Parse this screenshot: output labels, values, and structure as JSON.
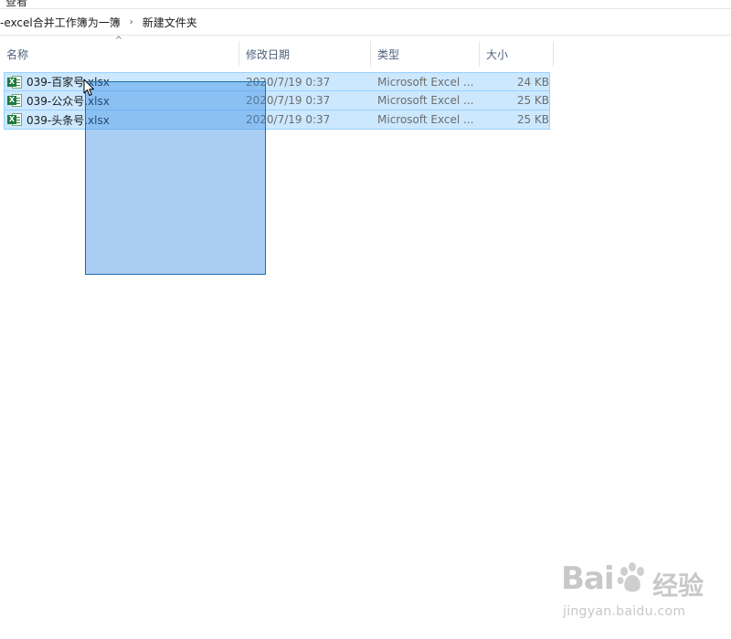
{
  "window": {
    "ribbon_remnant_label": "查看"
  },
  "breadcrumb": {
    "items": [
      "-excel合并工作簿为一簿",
      "新建文件夹"
    ],
    "separator": "›"
  },
  "columns": {
    "name": "名称",
    "date": "修改日期",
    "type": "类型",
    "size": "大小",
    "sort_indicator": "^"
  },
  "files": [
    {
      "name": "039-百家号.xlsx",
      "date": "2020/7/19 0:37",
      "type": "Microsoft Excel ...",
      "size": "24 KB",
      "icon": "excel-file-icon",
      "selected": true
    },
    {
      "name": "039-公众号.xlsx",
      "date": "2020/7/19 0:37",
      "type": "Microsoft Excel ...",
      "size": "25 KB",
      "icon": "excel-file-icon",
      "selected": true
    },
    {
      "name": "039-头条号.xlsx",
      "date": "2020/7/19 0:37",
      "type": "Microsoft Excel ...",
      "size": "25 KB",
      "icon": "excel-file-icon",
      "selected": true
    }
  ],
  "watermark": {
    "brand_left": "Bai",
    "brand_right": "经验",
    "url": "jingyan.baidu.com"
  },
  "colors": {
    "selection_fill": "#cce8ff",
    "selection_border": "#99d1ff",
    "drag_rect": "#3389e2",
    "header_text": "#4c607a"
  }
}
